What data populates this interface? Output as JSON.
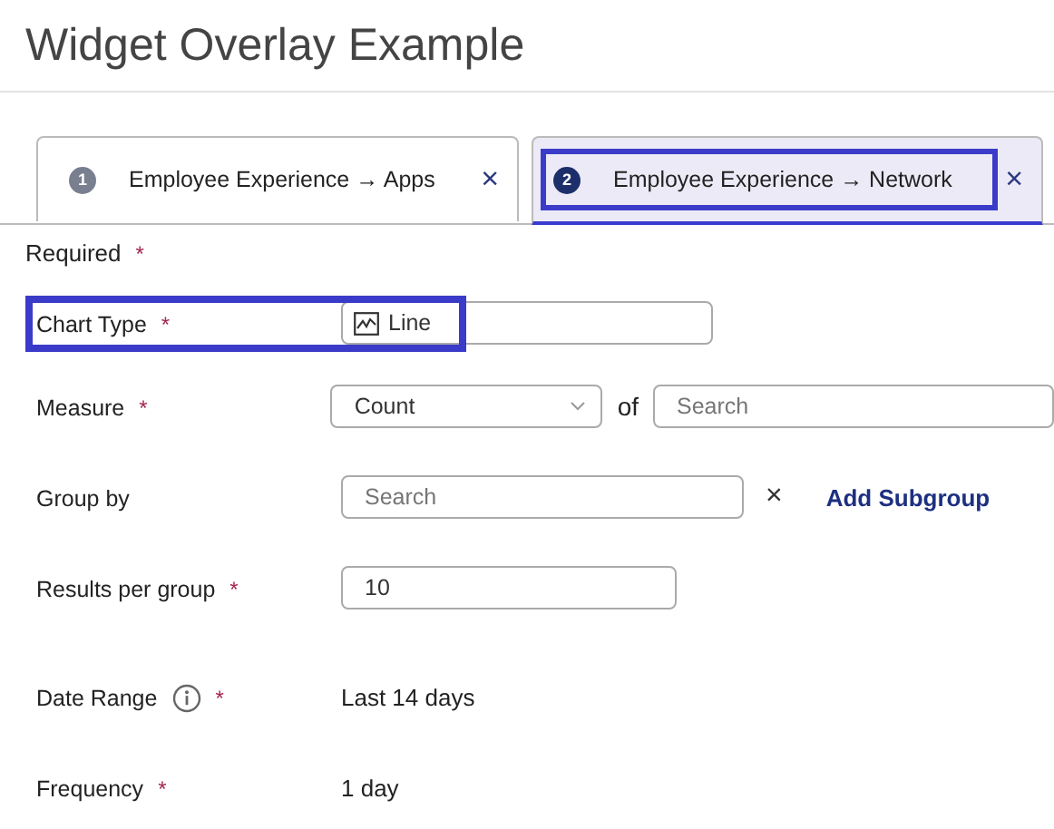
{
  "title": "Widget Overlay Example",
  "tabs": [
    {
      "number": "1",
      "label": "Employee Experience → Apps",
      "close": "×",
      "selected": false,
      "highlighted": false
    },
    {
      "number": "2",
      "label": "Employee Experience → Network",
      "close": "×",
      "selected": true,
      "highlighted": true
    }
  ],
  "required_note": {
    "label": "Required",
    "marker": "*"
  },
  "fields": [
    {
      "kind": "chart",
      "label": "Chart Type",
      "marker": "*",
      "value": "Line",
      "highlighted": true
    },
    {
      "kind": "measure",
      "label": "Measure",
      "marker": "*",
      "value": "Count",
      "joiner": "of",
      "placeholder": "Search"
    },
    {
      "kind": "group",
      "label": "Group by",
      "placeholder": "Search",
      "clear": "×",
      "link": "Add Subgroup"
    },
    {
      "kind": "input",
      "label": "Results per group",
      "marker": "*",
      "value": "10"
    },
    {
      "kind": "text",
      "label": "Date Range",
      "info": true,
      "marker": "*",
      "value": "Last 14 days"
    },
    {
      "kind": "text",
      "label": "Frequency",
      "marker": "*",
      "value": "1 day"
    }
  ]
}
